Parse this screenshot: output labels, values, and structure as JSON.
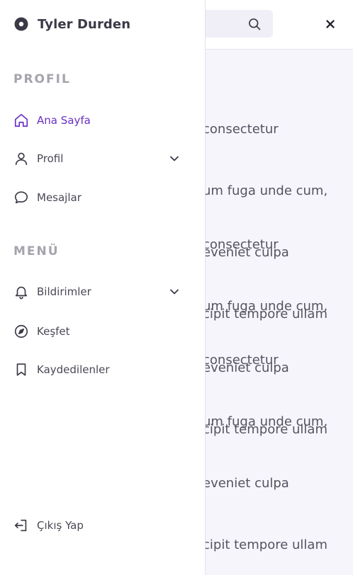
{
  "background": {
    "search": {
      "icon": "search-icon"
    },
    "close": {
      "icon": "close-icon"
    },
    "paragraphs": [
      [
        "consectetur",
        "um fuga unde cum,",
        "eveniet culpa",
        "cipit tempore ullam"
      ],
      [
        "consectetur",
        "um fuga unde cum,",
        "eveniet culpa",
        "cipit tempore ullam"
      ],
      [
        "consectetur",
        "um fuga unde cum,",
        "eveniet culpa",
        "cipit tempore ullam"
      ]
    ]
  },
  "sidebar": {
    "user_name": "Tyler Durden",
    "sections": [
      {
        "title": "PROFIL",
        "items": [
          {
            "label": "Ana Sayfa",
            "icon": "home-icon",
            "active": true
          },
          {
            "label": "Profil",
            "icon": "user-icon",
            "has_submenu": true
          },
          {
            "label": "Mesajlar",
            "icon": "message-icon"
          }
        ]
      },
      {
        "title": "MENÜ",
        "items": [
          {
            "label": "Bildirimler",
            "icon": "bell-icon",
            "has_submenu": true
          },
          {
            "label": "Keşfet",
            "icon": "compass-icon"
          },
          {
            "label": "Kaydedilenler",
            "icon": "bookmark-icon"
          }
        ]
      }
    ],
    "logout_label": "Çıkış Yap"
  },
  "colors": {
    "accent": "#6a2fc4",
    "muted_heading": "#a5a4ad",
    "page_background": "#f7f5fc"
  }
}
